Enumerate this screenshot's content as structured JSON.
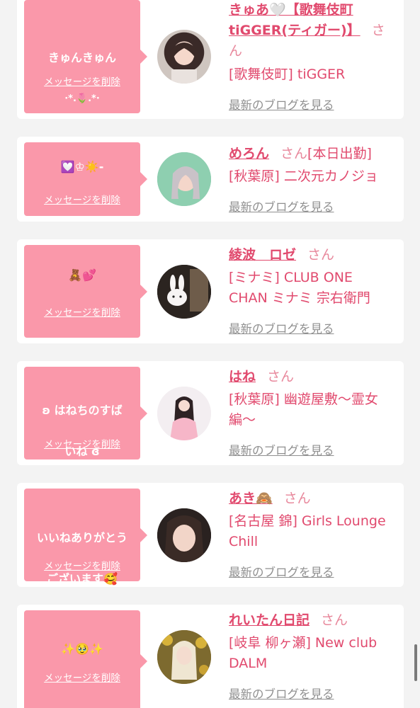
{
  "colors": {
    "bubble": "#fa98aa",
    "accent": "#e14a6e",
    "muted": "#909090",
    "page_bg": "#f3f3f3"
  },
  "delete_label": "メッセージを削除",
  "blog_label": "最新のブログを見る",
  "san_label": "さん",
  "entries": [
    {
      "message": [
        "きゅんきゅん",
        "·*.🌷.*·"
      ],
      "name_lines": [
        "きゅあ🤍【歌舞伎町",
        "tiGGER(ティガー)】"
      ],
      "san_lines": [
        "さ",
        "ん"
      ],
      "shop_lines": [
        "[歌舞伎町] tiGGER"
      ]
    },
    {
      "message": [
        "💟♔☀️-"
      ],
      "name_lines": [
        "めろん"
      ],
      "name_suffix": "[本日出勤]",
      "shop_lines": [
        "[秋葉原] 二次元カノジョ"
      ]
    },
    {
      "message": [
        "🧸💕"
      ],
      "name_lines": [
        "綾波　ロゼ"
      ],
      "shop_lines": [
        "[ミナミ] CLUB ONE",
        "CHAN ミナミ 宗右衛門"
      ]
    },
    {
      "message": [
        "ʚ はねちのすば",
        "いね ɞ"
      ],
      "name_lines": [
        "はね"
      ],
      "shop_lines": [
        "[秋葉原] 幽遊屋敷〜霊女",
        "編〜"
      ]
    },
    {
      "message": [
        "いいねありがとう",
        "ございます🥰"
      ],
      "name_lines": [
        "あき🙈"
      ],
      "shop_lines": [
        "[名古屋 錦] Girls Lounge",
        "Chill"
      ]
    },
    {
      "message": [
        "✨🥹✨"
      ],
      "name_lines": [
        "れいたん日記"
      ],
      "shop_lines": [
        "[岐阜 柳ヶ瀬] New club",
        "DALM"
      ]
    }
  ]
}
